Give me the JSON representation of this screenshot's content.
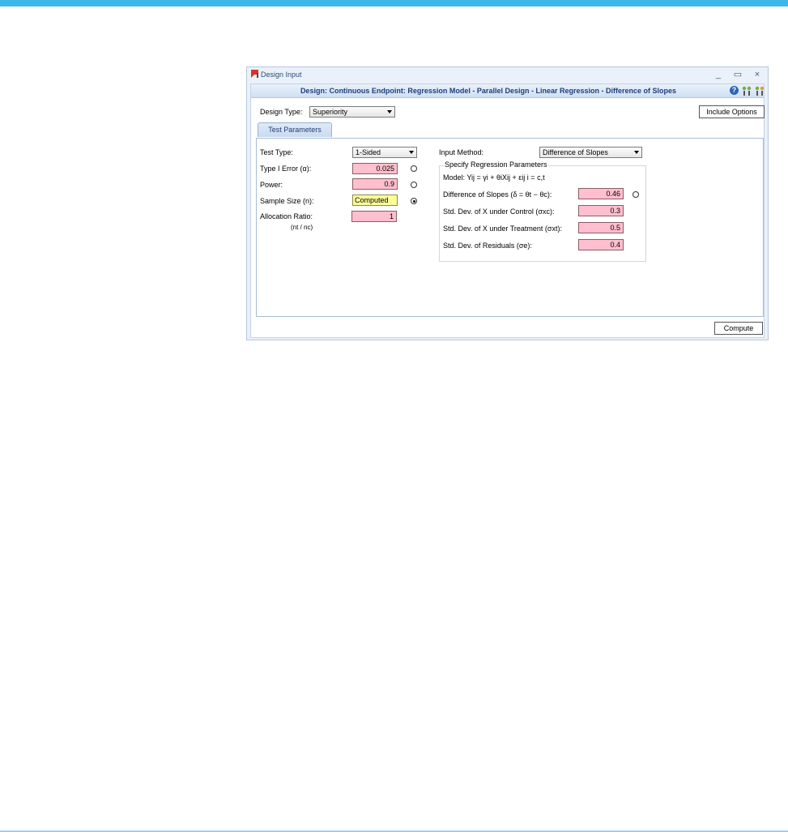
{
  "window": {
    "title": "Design Input",
    "controls": {
      "minimize": "_",
      "maximize": "▭",
      "close": "×"
    }
  },
  "header": {
    "title": "Design: Continuous Endpoint: Regression Model - Parallel Design - Linear Regression - Difference of Slopes",
    "icons": [
      "help-icon",
      "settings-icon-1",
      "settings-icon-2"
    ]
  },
  "design_type": {
    "label": "Design Type:",
    "value": "Superiority"
  },
  "include_options_label": "Include Options",
  "tab": {
    "label": "Test Parameters"
  },
  "left": {
    "test_type": {
      "label": "Test Type:",
      "value": "1-Sided"
    },
    "type1_error": {
      "label": "Type I Error (α):",
      "value": "0.025"
    },
    "power": {
      "label": "Power:",
      "value": "0.9"
    },
    "sample_size": {
      "label": "Sample Size (n):",
      "value": "Computed"
    },
    "allocation": {
      "label": "Allocation Ratio:",
      "sublabel": "(nt / nc)",
      "value": "1"
    }
  },
  "right": {
    "input_method": {
      "label": "Input Method:",
      "value": "Difference of Slopes"
    },
    "group_title": "Specify Regression Parameters",
    "model": "Model: Yij = γi + θiXij + εij  i = c,t",
    "diff_slopes": {
      "label": "Difference of Slopes (δ = θt − θc):",
      "value": "0.46"
    },
    "sd_x_control": {
      "label": "Std. Dev. of X under Control (σxc):",
      "value": "0.3"
    },
    "sd_x_treatment": {
      "label": "Std. Dev. of X under Treatment (σxt):",
      "value": "0.5"
    },
    "sd_residuals": {
      "label": "Std. Dev. of Residuals (σe):",
      "value": "0.4"
    }
  },
  "compute_label": "Compute"
}
